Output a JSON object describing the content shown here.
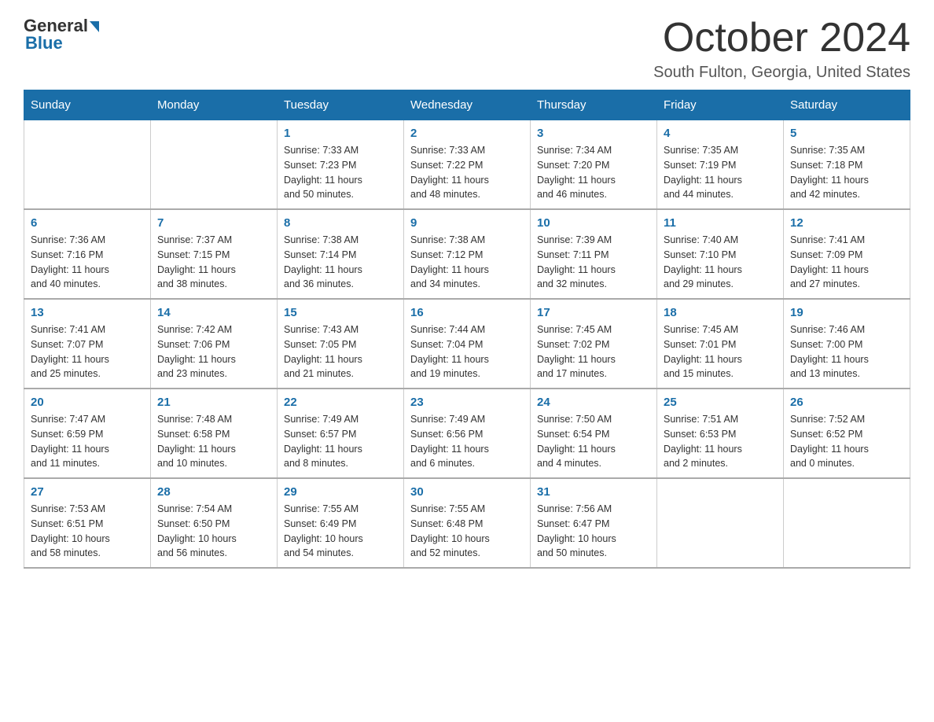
{
  "header": {
    "logo_text_general": "General",
    "logo_text_blue": "Blue",
    "month_title": "October 2024",
    "location": "South Fulton, Georgia, United States"
  },
  "weekdays": [
    "Sunday",
    "Monday",
    "Tuesday",
    "Wednesday",
    "Thursday",
    "Friday",
    "Saturday"
  ],
  "weeks": [
    [
      {
        "day": "",
        "info": ""
      },
      {
        "day": "",
        "info": ""
      },
      {
        "day": "1",
        "info": "Sunrise: 7:33 AM\nSunset: 7:23 PM\nDaylight: 11 hours\nand 50 minutes."
      },
      {
        "day": "2",
        "info": "Sunrise: 7:33 AM\nSunset: 7:22 PM\nDaylight: 11 hours\nand 48 minutes."
      },
      {
        "day": "3",
        "info": "Sunrise: 7:34 AM\nSunset: 7:20 PM\nDaylight: 11 hours\nand 46 minutes."
      },
      {
        "day": "4",
        "info": "Sunrise: 7:35 AM\nSunset: 7:19 PM\nDaylight: 11 hours\nand 44 minutes."
      },
      {
        "day": "5",
        "info": "Sunrise: 7:35 AM\nSunset: 7:18 PM\nDaylight: 11 hours\nand 42 minutes."
      }
    ],
    [
      {
        "day": "6",
        "info": "Sunrise: 7:36 AM\nSunset: 7:16 PM\nDaylight: 11 hours\nand 40 minutes."
      },
      {
        "day": "7",
        "info": "Sunrise: 7:37 AM\nSunset: 7:15 PM\nDaylight: 11 hours\nand 38 minutes."
      },
      {
        "day": "8",
        "info": "Sunrise: 7:38 AM\nSunset: 7:14 PM\nDaylight: 11 hours\nand 36 minutes."
      },
      {
        "day": "9",
        "info": "Sunrise: 7:38 AM\nSunset: 7:12 PM\nDaylight: 11 hours\nand 34 minutes."
      },
      {
        "day": "10",
        "info": "Sunrise: 7:39 AM\nSunset: 7:11 PM\nDaylight: 11 hours\nand 32 minutes."
      },
      {
        "day": "11",
        "info": "Sunrise: 7:40 AM\nSunset: 7:10 PM\nDaylight: 11 hours\nand 29 minutes."
      },
      {
        "day": "12",
        "info": "Sunrise: 7:41 AM\nSunset: 7:09 PM\nDaylight: 11 hours\nand 27 minutes."
      }
    ],
    [
      {
        "day": "13",
        "info": "Sunrise: 7:41 AM\nSunset: 7:07 PM\nDaylight: 11 hours\nand 25 minutes."
      },
      {
        "day": "14",
        "info": "Sunrise: 7:42 AM\nSunset: 7:06 PM\nDaylight: 11 hours\nand 23 minutes."
      },
      {
        "day": "15",
        "info": "Sunrise: 7:43 AM\nSunset: 7:05 PM\nDaylight: 11 hours\nand 21 minutes."
      },
      {
        "day": "16",
        "info": "Sunrise: 7:44 AM\nSunset: 7:04 PM\nDaylight: 11 hours\nand 19 minutes."
      },
      {
        "day": "17",
        "info": "Sunrise: 7:45 AM\nSunset: 7:02 PM\nDaylight: 11 hours\nand 17 minutes."
      },
      {
        "day": "18",
        "info": "Sunrise: 7:45 AM\nSunset: 7:01 PM\nDaylight: 11 hours\nand 15 minutes."
      },
      {
        "day": "19",
        "info": "Sunrise: 7:46 AM\nSunset: 7:00 PM\nDaylight: 11 hours\nand 13 minutes."
      }
    ],
    [
      {
        "day": "20",
        "info": "Sunrise: 7:47 AM\nSunset: 6:59 PM\nDaylight: 11 hours\nand 11 minutes."
      },
      {
        "day": "21",
        "info": "Sunrise: 7:48 AM\nSunset: 6:58 PM\nDaylight: 11 hours\nand 10 minutes."
      },
      {
        "day": "22",
        "info": "Sunrise: 7:49 AM\nSunset: 6:57 PM\nDaylight: 11 hours\nand 8 minutes."
      },
      {
        "day": "23",
        "info": "Sunrise: 7:49 AM\nSunset: 6:56 PM\nDaylight: 11 hours\nand 6 minutes."
      },
      {
        "day": "24",
        "info": "Sunrise: 7:50 AM\nSunset: 6:54 PM\nDaylight: 11 hours\nand 4 minutes."
      },
      {
        "day": "25",
        "info": "Sunrise: 7:51 AM\nSunset: 6:53 PM\nDaylight: 11 hours\nand 2 minutes."
      },
      {
        "day": "26",
        "info": "Sunrise: 7:52 AM\nSunset: 6:52 PM\nDaylight: 11 hours\nand 0 minutes."
      }
    ],
    [
      {
        "day": "27",
        "info": "Sunrise: 7:53 AM\nSunset: 6:51 PM\nDaylight: 10 hours\nand 58 minutes."
      },
      {
        "day": "28",
        "info": "Sunrise: 7:54 AM\nSunset: 6:50 PM\nDaylight: 10 hours\nand 56 minutes."
      },
      {
        "day": "29",
        "info": "Sunrise: 7:55 AM\nSunset: 6:49 PM\nDaylight: 10 hours\nand 54 minutes."
      },
      {
        "day": "30",
        "info": "Sunrise: 7:55 AM\nSunset: 6:48 PM\nDaylight: 10 hours\nand 52 minutes."
      },
      {
        "day": "31",
        "info": "Sunrise: 7:56 AM\nSunset: 6:47 PM\nDaylight: 10 hours\nand 50 minutes."
      },
      {
        "day": "",
        "info": ""
      },
      {
        "day": "",
        "info": ""
      }
    ]
  ]
}
